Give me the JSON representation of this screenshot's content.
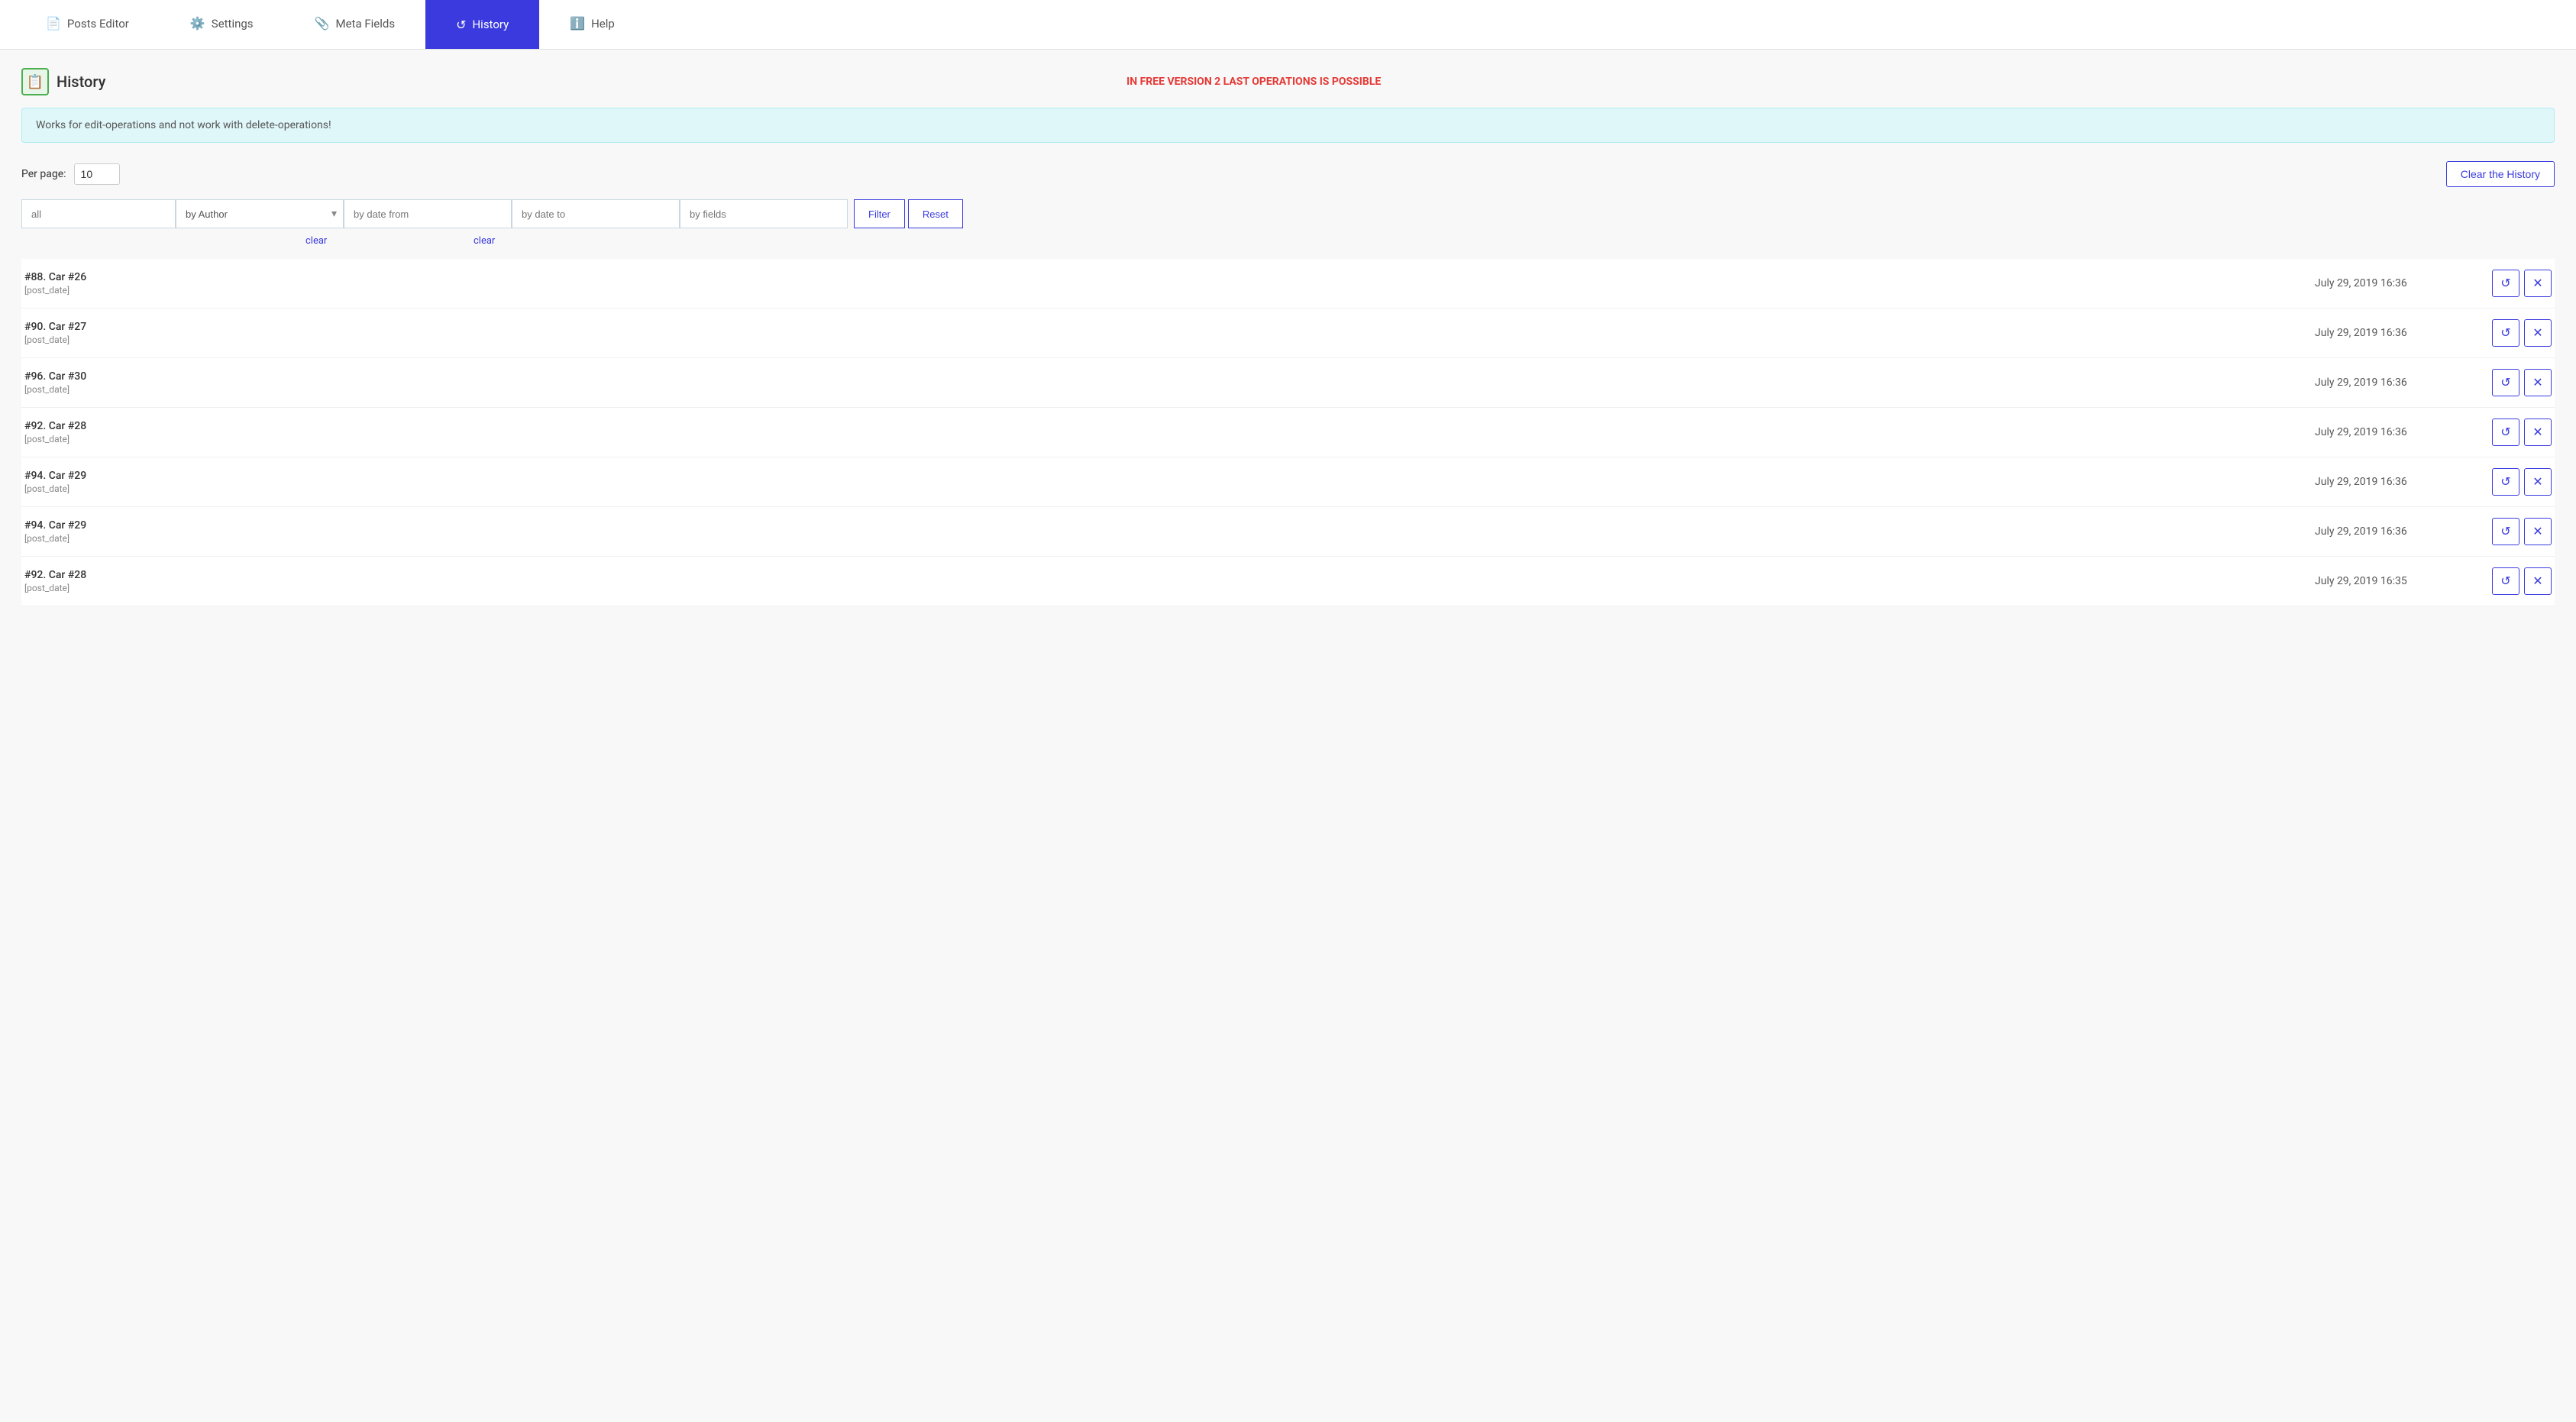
{
  "nav": {
    "items": [
      {
        "id": "posts-editor",
        "label": "Posts Editor",
        "icon": "📄",
        "active": false
      },
      {
        "id": "settings",
        "label": "Settings",
        "icon": "⚙️",
        "active": false
      },
      {
        "id": "meta-fields",
        "label": "Meta Fields",
        "icon": "📎",
        "active": false
      },
      {
        "id": "history",
        "label": "History",
        "icon": "↺",
        "active": true
      },
      {
        "id": "help",
        "label": "Help",
        "icon": "ℹ️",
        "active": false
      }
    ]
  },
  "page": {
    "icon": "📋",
    "title": "History",
    "free_notice": "IN FREE VERSION 2 LAST OPERATIONS IS POSSIBLE",
    "info_banner": "Works for edit-operations and not work with delete-operations!",
    "per_page_label": "Per page:",
    "per_page_value": "10",
    "clear_history_label": "Clear the History"
  },
  "filters": {
    "all_placeholder": "all",
    "author_placeholder": "by Author",
    "date_from_placeholder": "by date from",
    "date_to_placeholder": "by date to",
    "fields_placeholder": "by fields",
    "filter_label": "Filter",
    "reset_label": "Reset",
    "clear_from_label": "clear",
    "clear_to_label": "clear"
  },
  "rows": [
    {
      "id": "88",
      "title": "#88. Car #26",
      "meta": "[post_date]",
      "date": "July 29, 2019 16:36"
    },
    {
      "id": "90",
      "title": "#90. Car #27",
      "meta": "[post_date]",
      "date": "July 29, 2019 16:36"
    },
    {
      "id": "96",
      "title": "#96. Car #30",
      "meta": "[post_date]",
      "date": "July 29, 2019 16:36"
    },
    {
      "id": "92",
      "title": "#92. Car #28",
      "meta": "[post_date]",
      "date": "July 29, 2019 16:36"
    },
    {
      "id": "94a",
      "title": "#94. Car #29",
      "meta": "[post_date]",
      "date": "July 29, 2019 16:36"
    },
    {
      "id": "94b",
      "title": "#94. Car #29",
      "meta": "[post_date]",
      "date": "July 29, 2019 16:36"
    },
    {
      "id": "92b",
      "title": "#92. Car #28",
      "meta": "[post_date]",
      "date": "July 29, 2019 16:35"
    }
  ],
  "actions": {
    "restore_icon": "↺",
    "delete_icon": "✕"
  }
}
